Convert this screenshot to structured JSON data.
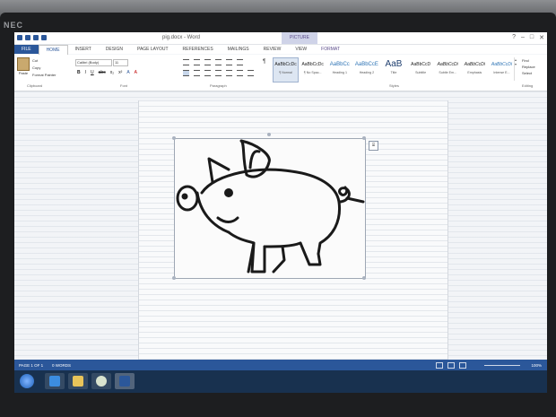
{
  "monitor": {
    "brand": "NEC"
  },
  "window": {
    "title": "pig.docx - Word",
    "contextual_tab": "PICTURE TOOLS",
    "controls": [
      "?",
      "–",
      "□",
      "✕"
    ]
  },
  "tabs": [
    "FILE",
    "HOME",
    "INSERT",
    "DESIGN",
    "PAGE LAYOUT",
    "REFERENCES",
    "MAILINGS",
    "REVIEW",
    "VIEW",
    "FORMAT"
  ],
  "active_tab": "HOME",
  "ribbon": {
    "clipboard": {
      "paste": "Paste",
      "items": [
        "Cut",
        "Copy",
        "Format Painter"
      ],
      "group": "Clipboard"
    },
    "font": {
      "name": "Calibri (Body)",
      "size": "11",
      "format_buttons": [
        "B",
        "I",
        "U",
        "abc",
        "x₂",
        "x²",
        "A",
        "A"
      ],
      "group": "Font"
    },
    "paragraph": {
      "group": "Paragraph",
      "pilcrow": "¶"
    },
    "styles": {
      "group": "Styles",
      "items": [
        {
          "sample": "AaBbCcDc",
          "name": "¶ Normal"
        },
        {
          "sample": "AaBbCcDc",
          "name": "¶ No Spac..."
        },
        {
          "sample": "AaBbCc",
          "name": "Heading 1"
        },
        {
          "sample": "AaBbCcE",
          "name": "Heading 2"
        },
        {
          "sample": "AaB",
          "name": "Title"
        },
        {
          "sample": "AaBbCcD",
          "name": "Subtitle"
        },
        {
          "sample": "AaBbCcDi",
          "name": "Subtle Em..."
        },
        {
          "sample": "AaBbCcDi",
          "name": "Emphasis"
        },
        {
          "sample": "AaBbCcDi",
          "name": "Intense E..."
        }
      ]
    },
    "editing": {
      "items": [
        "Find",
        "Replace",
        "Select"
      ],
      "group": "Editing"
    }
  },
  "statusbar": {
    "page": "PAGE 1 OF 1",
    "words": "0 WORDS",
    "zoom": "100%"
  },
  "colors": {
    "accent": "#2b579a",
    "taskbar": "#18314f"
  },
  "icons": [
    "paste-icon",
    "layout-options-icon",
    "rotate-handle-icon",
    "start-orb-icon",
    "ie-icon",
    "explorer-icon",
    "chrome-icon",
    "word-icon"
  ]
}
